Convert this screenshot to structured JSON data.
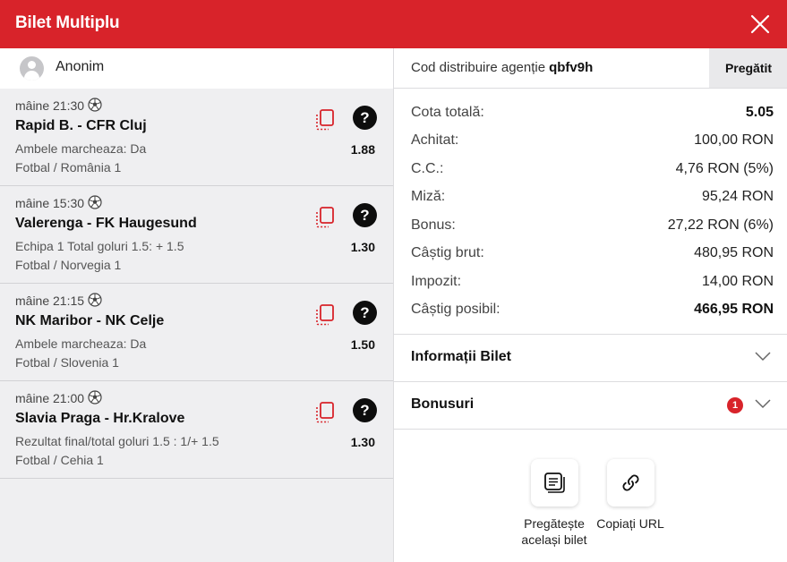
{
  "header": {
    "title": "Bilet Multiplu"
  },
  "user": {
    "name": "Anonim"
  },
  "bets": [
    {
      "time": "mâine 21:30",
      "match": "Rapid B. - CFR Cluj",
      "market": "Ambele marcheaza: Da",
      "league": "Fotbal / România 1",
      "odd": "1.88"
    },
    {
      "time": "mâine 15:30",
      "match": "Valerenga - FK Haugesund",
      "market": "Echipa 1 Total goluri 1.5: + 1.5",
      "league": "Fotbal / Norvegia 1",
      "odd": "1.30"
    },
    {
      "time": "mâine 21:15",
      "match": "NK Maribor - NK Celje",
      "market": "Ambele marcheaza: Da",
      "league": "Fotbal / Slovenia 1",
      "odd": "1.50"
    },
    {
      "time": "mâine 21:00",
      "match": "Slavia Praga - Hr.Kralove",
      "market": "Rezultat final/total goluri 1.5 : 1/+ 1.5",
      "league": "Fotbal / Cehia 1",
      "odd": "1.30"
    }
  ],
  "agent": {
    "label": "Cod distribuire agenție",
    "code": "qbfv9h",
    "button": "Pregătit"
  },
  "summary": {
    "cota_label": "Cota totală:",
    "cota_value": "5.05",
    "achitat_label": "Achitat:",
    "achitat_value": "100,00 RON",
    "cc_label": "C.C.:",
    "cc_value": "4,76 RON (5%)",
    "miza_label": "Miză:",
    "miza_value": "95,24 RON",
    "bonus_label": "Bonus:",
    "bonus_value": "27,22 RON (6%)",
    "brut_label": "Câștig brut:",
    "brut_value": "480,95 RON",
    "impozit_label": "Impozit:",
    "impozit_value": "14,00 RON",
    "posibil_label": "Câștig posibil:",
    "posibil_value": "466,95 RON"
  },
  "accordions": {
    "info_label": "Informații Bilet",
    "bonus_label": "Bonusuri",
    "bonus_badge": "1"
  },
  "actions": {
    "prepare_line1": "Pregătește",
    "prepare_line2": "același bilet",
    "copy_url": "Copiați URL"
  },
  "colors": {
    "brand_red": "#d8232a"
  },
  "icons": [
    "close-icon",
    "user-avatar-icon",
    "soccer-ball-icon",
    "copy-icon",
    "help-icon",
    "chevron-down-icon",
    "ticket-icon",
    "link-icon"
  ]
}
